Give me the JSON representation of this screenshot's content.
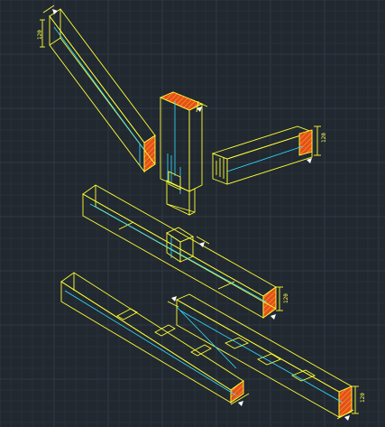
{
  "colors": {
    "background": "#212830",
    "grid_minor": "#283038",
    "grid_major": "#2f3a44",
    "outline": "#ffff33",
    "hidden": "#33e0ff",
    "section_fill": "#e5501a",
    "section_hatch": "#ffcc33",
    "marker": "#ffffff"
  },
  "annotations": {
    "top_left_beam_height": "120",
    "right_beam_height": "120",
    "middle_beam_height": "120",
    "lower_beam_height": "120"
  }
}
